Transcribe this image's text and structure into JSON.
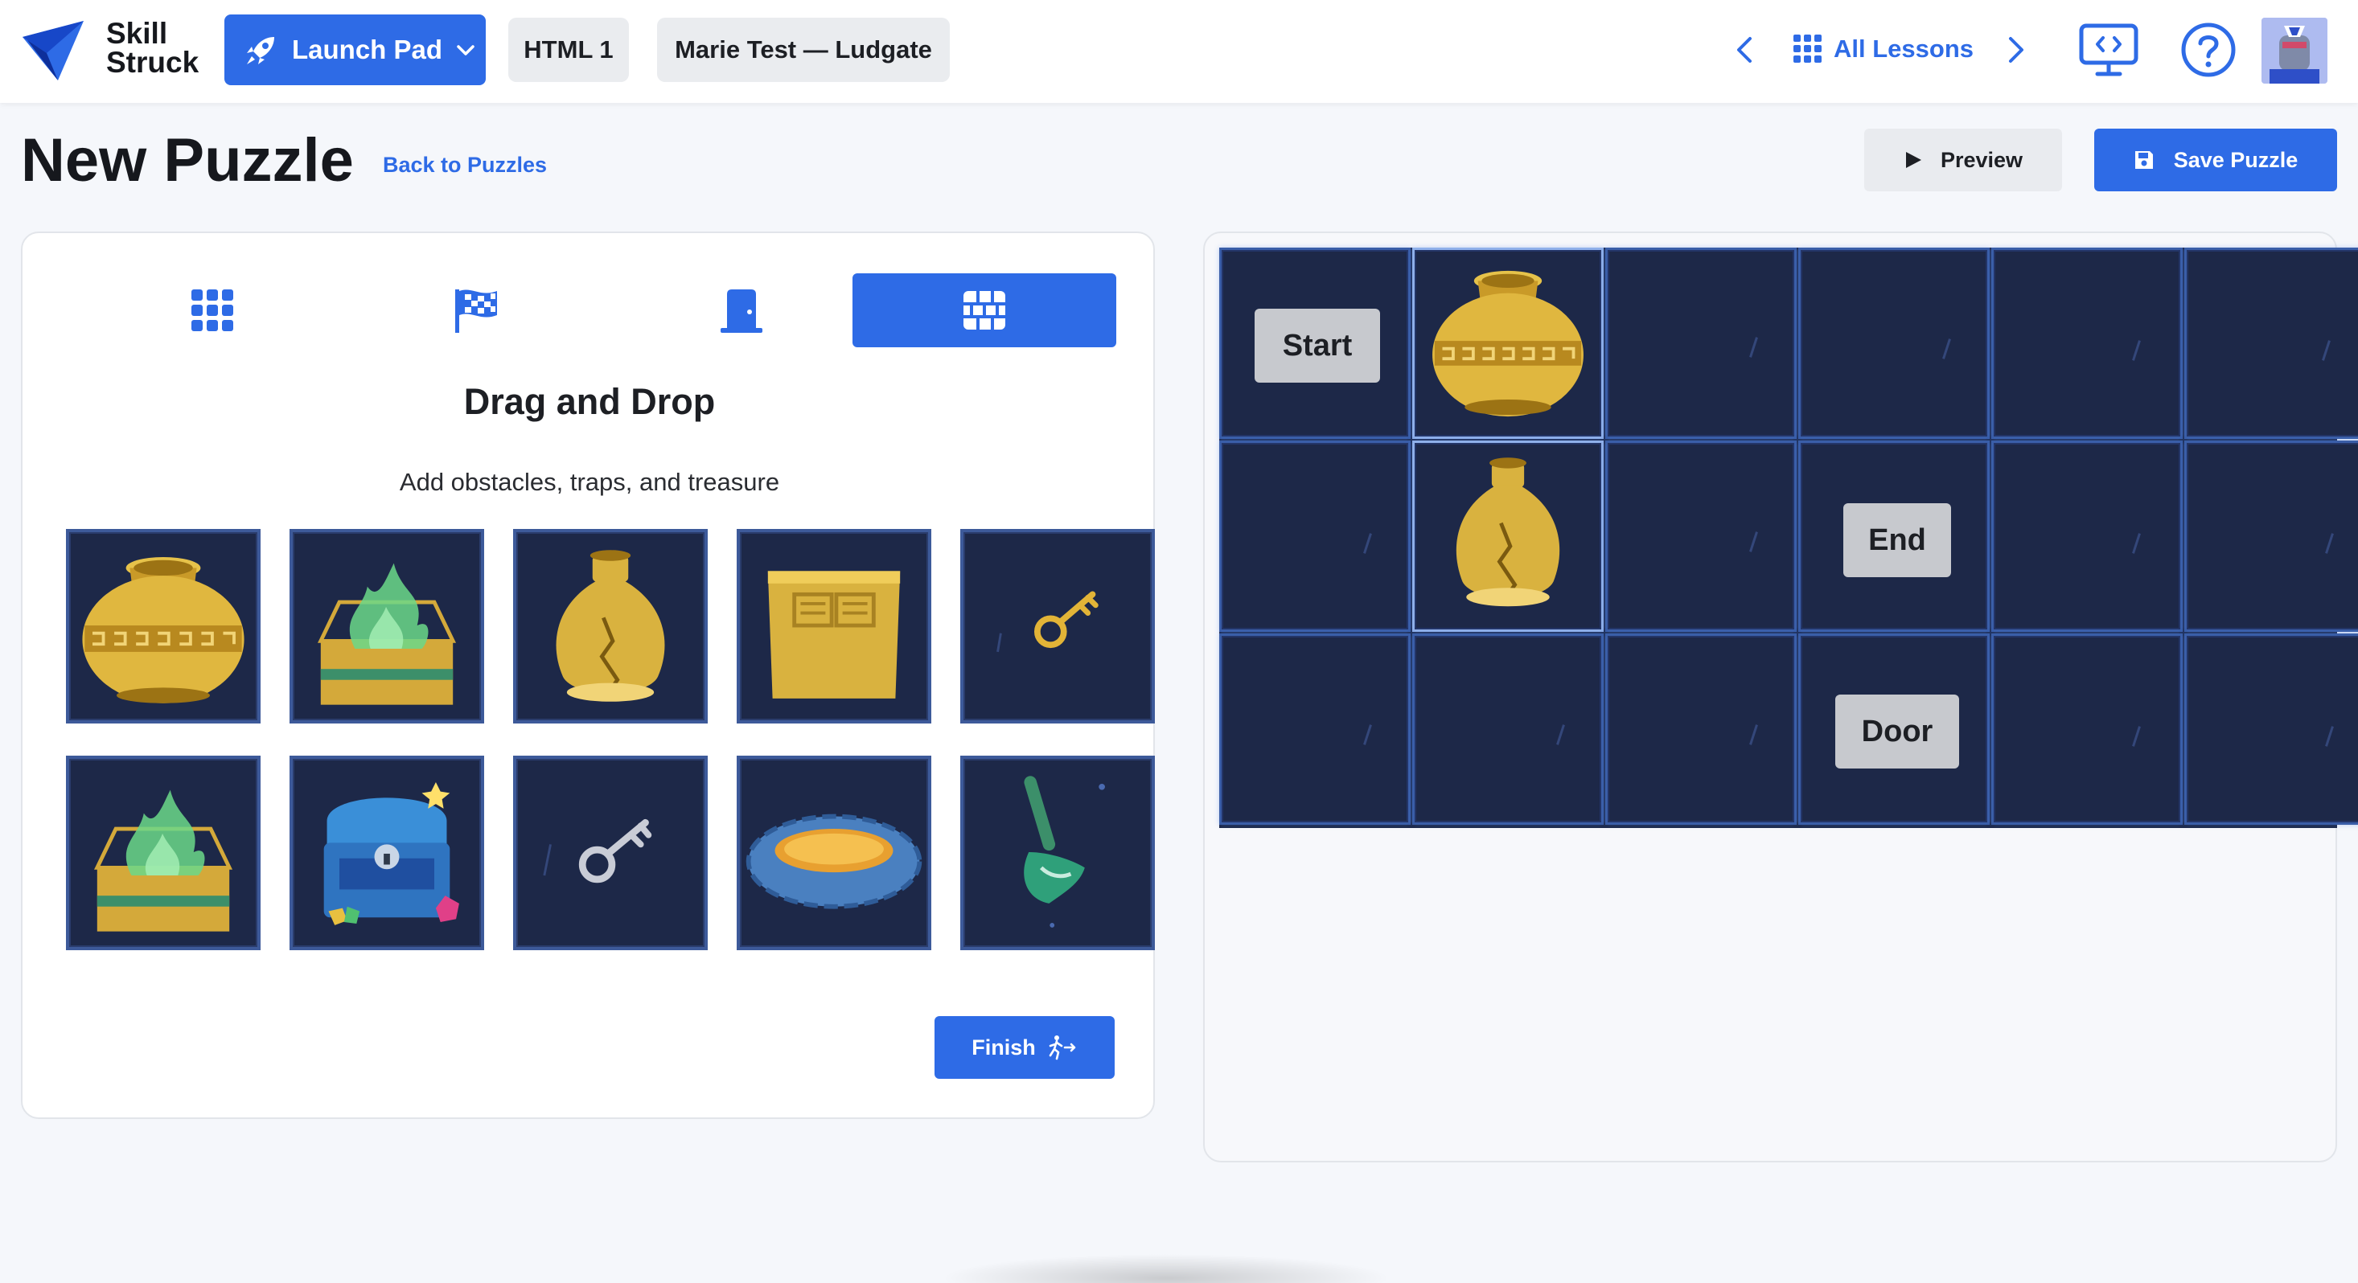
{
  "navbar": {
    "logo_text_line1": "Skill",
    "logo_text_line2": "Struck",
    "launch_pad_label": "Launch Pad",
    "course_label": "HTML 1",
    "class_label": "Marie Test — Ludgate",
    "all_lessons_label": "All Lessons",
    "icons": [
      "rocket-icon",
      "chevron-down-icon",
      "chevron-left-icon",
      "grid-icon",
      "chevron-right-icon",
      "code-screen-icon",
      "help-icon",
      "avatar"
    ]
  },
  "header": {
    "title": "New Puzzle",
    "back_link": "Back to Puzzles",
    "preview_label": "Preview",
    "save_label": "Save Puzzle"
  },
  "editor": {
    "tabs": [
      {
        "id": "grid",
        "icon": "grid-icon",
        "active": false
      },
      {
        "id": "flag",
        "icon": "checkered-flag-icon",
        "active": false
      },
      {
        "id": "door",
        "icon": "door-icon",
        "active": false
      },
      {
        "id": "wall",
        "icon": "brick-wall-icon",
        "active": true
      }
    ],
    "heading": "Drag and Drop",
    "subheading": "Add obstacles, traps, and treasure",
    "palette": [
      "large-vase",
      "fire-trap",
      "cracked-vase",
      "stone-block",
      "gold-key",
      "fire-trap",
      "treasure-chest",
      "silver-key",
      "lava-pit",
      "shovel"
    ],
    "finish_label": "Finish"
  },
  "board": {
    "rows": 3,
    "cols": 6,
    "labels": {
      "start": "Start",
      "end": "End",
      "door": "Door"
    },
    "placed_items": [
      {
        "row": 0,
        "col": 1,
        "item": "large-vase"
      },
      {
        "row": 1,
        "col": 1,
        "item": "cracked-vase"
      }
    ]
  },
  "colors": {
    "accent": "#2e6be6",
    "tile_bg": "#1d2848",
    "tile_border": "#3a5ea8",
    "gold": "#d9b23f"
  }
}
